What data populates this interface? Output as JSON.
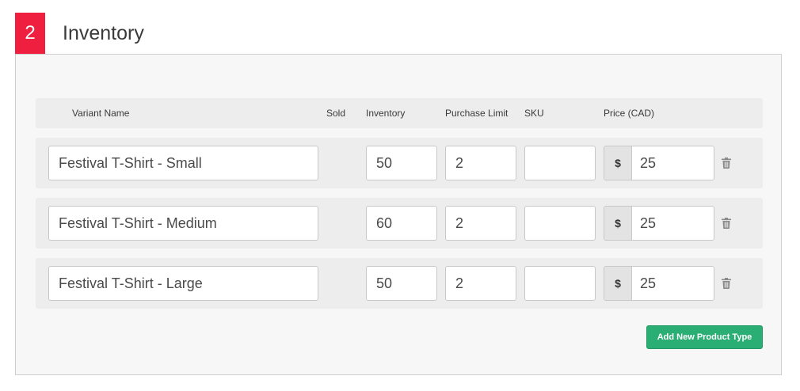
{
  "section": {
    "step_number": "2",
    "title": "Inventory"
  },
  "table": {
    "headers": {
      "variant_name": "Variant Name",
      "sold": "Sold",
      "inventory": "Inventory",
      "purchase_limit": "Purchase Limit",
      "sku": "SKU",
      "price": "Price (CAD)"
    },
    "currency_symbol": "$",
    "rows": [
      {
        "name": "Festival T-Shirt - Small",
        "sold": "",
        "inventory": "50",
        "purchase_limit": "2",
        "sku": "",
        "price": "25"
      },
      {
        "name": "Festival T-Shirt - Medium",
        "sold": "",
        "inventory": "60",
        "purchase_limit": "2",
        "sku": "",
        "price": "25"
      },
      {
        "name": "Festival T-Shirt - Large",
        "sold": "",
        "inventory": "50",
        "purchase_limit": "2",
        "sku": "",
        "price": "25"
      }
    ]
  },
  "actions": {
    "add_label": "Add New Product Type"
  },
  "icons": {
    "delete": "trash-icon"
  },
  "colors": {
    "badge": "#ef1f3f",
    "button": "#2aae74"
  }
}
